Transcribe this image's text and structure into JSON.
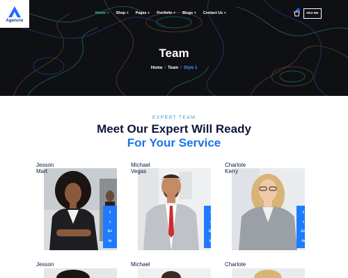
{
  "brand": {
    "name": "Agencio"
  },
  "nav": {
    "items": [
      "Home +",
      "Shop +",
      "Pages +",
      "Portfolio +",
      "Blogs +",
      "Contact Us +"
    ],
    "hire_label": "Hire Me"
  },
  "hero": {
    "title": "Team",
    "breadcrumb": {
      "home": "Home",
      "team": "Team",
      "current": "Style 1",
      "separator": "/"
    }
  },
  "section": {
    "eyebrow": "EXPERT TEAM",
    "heading_line1": "Meet Our Expert Will Ready",
    "heading_line2": "For Your Service"
  },
  "team": [
    {
      "name": "Jesson Mart"
    },
    {
      "name": "Michael Vegas"
    },
    {
      "name": "Charlote Kerry"
    }
  ],
  "team_row2": [
    {
      "name": "Jesson"
    },
    {
      "name": "Michael"
    },
    {
      "name": "Charlote"
    }
  ],
  "social_icons": [
    "f",
    "t",
    "G+",
    "in"
  ],
  "colors": {
    "accent": "#1e7bff",
    "active_nav": "#34d399",
    "heading": "#10163a",
    "hero_bg": "#0f1014"
  }
}
